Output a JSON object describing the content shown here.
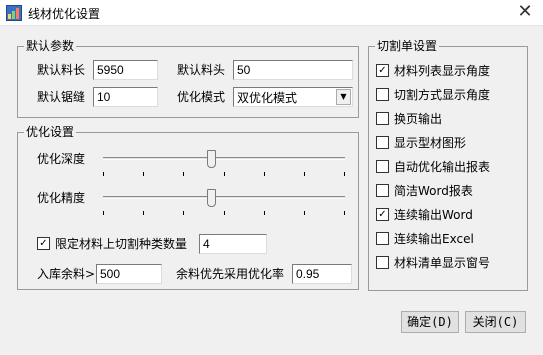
{
  "window": {
    "title": "线材优化设置",
    "close_glyph": "✕"
  },
  "defaults": {
    "group_title": "默认参数",
    "stock_length": {
      "label": "默认料长",
      "value": "5950"
    },
    "stock_head": {
      "label": "默认料头",
      "value": "50"
    },
    "saw_gap": {
      "label": "默认锯缝",
      "value": "10"
    },
    "opt_mode": {
      "label": "优化模式",
      "value": "双优化模式"
    }
  },
  "optimize": {
    "group_title": "优化设置",
    "depth": {
      "label": "优化深度",
      "level": 0.43
    },
    "precision": {
      "label": "优化精度",
      "level": 0.43
    },
    "limit": {
      "label": "限定材料上切割种类数量",
      "checked": true,
      "value": "4"
    },
    "store_remain": {
      "label": "入库余料>",
      "value": "500"
    },
    "remain_rate": {
      "label": "余料优先采用优化率",
      "value": "0.95"
    }
  },
  "cut_sheet": {
    "group_title": "切割单设置",
    "items": [
      {
        "label": "材料列表显示角度",
        "checked": true
      },
      {
        "label": "切割方式显示角度",
        "checked": false
      },
      {
        "label": "换页输出",
        "checked": false
      },
      {
        "label": "显示型材图形",
        "checked": false
      },
      {
        "label": "自动优化输出报表",
        "checked": false
      },
      {
        "label": "简洁Word报表",
        "checked": false
      },
      {
        "label": "连续输出Word",
        "checked": true
      },
      {
        "label": "连续输出Excel",
        "checked": false
      },
      {
        "label": "材料清单显示窗号",
        "checked": false
      }
    ]
  },
  "buttons": {
    "ok": "确定(D)",
    "close": "关闭(C)"
  },
  "colors": {
    "background": "#f0f0f0",
    "titlebar": "#ffffff",
    "border": "#9a9a9a"
  }
}
